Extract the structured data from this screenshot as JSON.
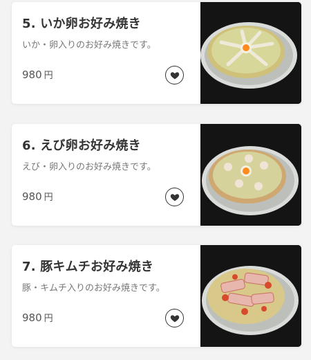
{
  "items": [
    {
      "title": "5. いか卵お好み焼き",
      "description": "いか・卵入りのお好み焼きです。",
      "price": "980",
      "currency": "円",
      "icon": "heart-icon",
      "photo": "okonomiyaki-squid-egg-photo"
    },
    {
      "title": "6. えび卵お好み焼き",
      "description": "えび・卵入りのお好み焼きです。",
      "price": "980",
      "currency": "円",
      "icon": "heart-icon",
      "photo": "okonomiyaki-shrimp-egg-photo"
    },
    {
      "title": "7. 豚キムチお好み焼き",
      "description": "豚・キムチ入りのお好み焼きです。",
      "price": "980",
      "currency": "円",
      "icon": "heart-icon",
      "photo": "okonomiyaki-pork-kimchi-photo"
    }
  ],
  "colors": {
    "background": "#f3f3f3",
    "card": "#ffffff",
    "title": "#333333",
    "description": "#777777",
    "price": "#555555"
  }
}
